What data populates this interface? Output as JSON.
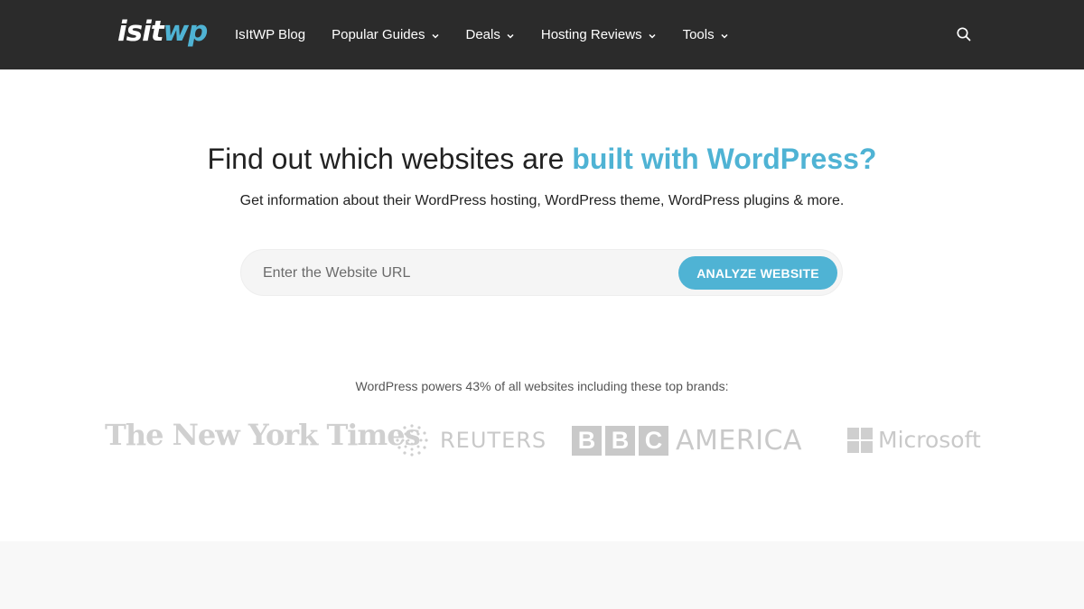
{
  "header": {
    "logo": {
      "part1": "isit",
      "part2": "wp"
    },
    "nav": [
      {
        "label": "IsItWP Blog",
        "dropdown": false
      },
      {
        "label": "Popular Guides",
        "dropdown": true
      },
      {
        "label": "Deals",
        "dropdown": true
      },
      {
        "label": "Hosting Reviews",
        "dropdown": true
      },
      {
        "label": "Tools",
        "dropdown": true
      }
    ],
    "search_icon": "search-icon"
  },
  "hero": {
    "title_plain": "Find out which websites are ",
    "title_accent": "built with WordPress?",
    "subtitle": "Get information about their WordPress hosting, WordPress theme, WordPress plugins & more.",
    "input_placeholder": "Enter the Website URL",
    "button_label": "ANALYZE WEBSITE"
  },
  "brands": {
    "caption": "WordPress powers 43% of all websites including these top brands:",
    "items": [
      {
        "name": "The New York Times"
      },
      {
        "name": "REUTERS"
      },
      {
        "letters": [
          "B",
          "B",
          "C"
        ],
        "suffix": "AMERICA"
      },
      {
        "name": "Microsoft"
      }
    ]
  },
  "colors": {
    "accent": "#4fb3d4",
    "header_bg": "#2b2b2b",
    "logo_gray": "#c9c9c9"
  }
}
